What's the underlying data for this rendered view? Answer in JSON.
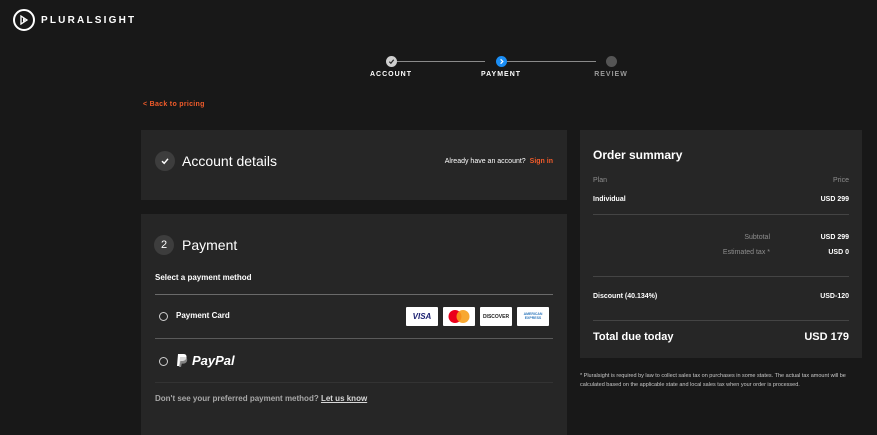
{
  "brand": {
    "name": "PLURALSIGHT"
  },
  "stepper": {
    "steps": [
      {
        "label": "ACCOUNT",
        "state": "done"
      },
      {
        "label": "PAYMENT",
        "state": "active"
      },
      {
        "label": "REVIEW",
        "state": "pending"
      }
    ]
  },
  "back_link": "< Back to pricing",
  "account": {
    "title": "Account details",
    "already_text": "Already have an account?",
    "signin_label": "Sign in"
  },
  "payment": {
    "step_number": "2",
    "title": "Payment",
    "subtitle": "Select a payment method",
    "card_option_label": "Payment Card",
    "card_brands": [
      "VISA",
      "MasterCard",
      "DISCOVER",
      "AMERICAN EXPRESS"
    ],
    "paypal_label": "PayPal",
    "dont_see_text": "Don't see your preferred payment method?",
    "let_us_know_label": "Let us know"
  },
  "summary": {
    "title": "Order summary",
    "plan_header": "Plan",
    "price_header": "Price",
    "plan_name": "Individual",
    "plan_price": "USD 299",
    "subtotal_label": "Subtotal",
    "subtotal_value": "USD 299",
    "tax_label": "Estimated tax *",
    "tax_value": "USD 0",
    "discount_label": "Discount (40.134%)",
    "discount_value": "USD-120",
    "total_label": "Total due today",
    "total_value": "USD 179"
  },
  "footnote": "* Pluralsight is required by law to collect sales tax on purchases in some states. The actual tax amount will be calculated based on the applicable state and local sales tax when your order is processed.",
  "colors": {
    "accent": "#f15b2a",
    "step_active": "#1b8ef5",
    "card_bg": "#262626",
    "page_bg": "#181818"
  }
}
